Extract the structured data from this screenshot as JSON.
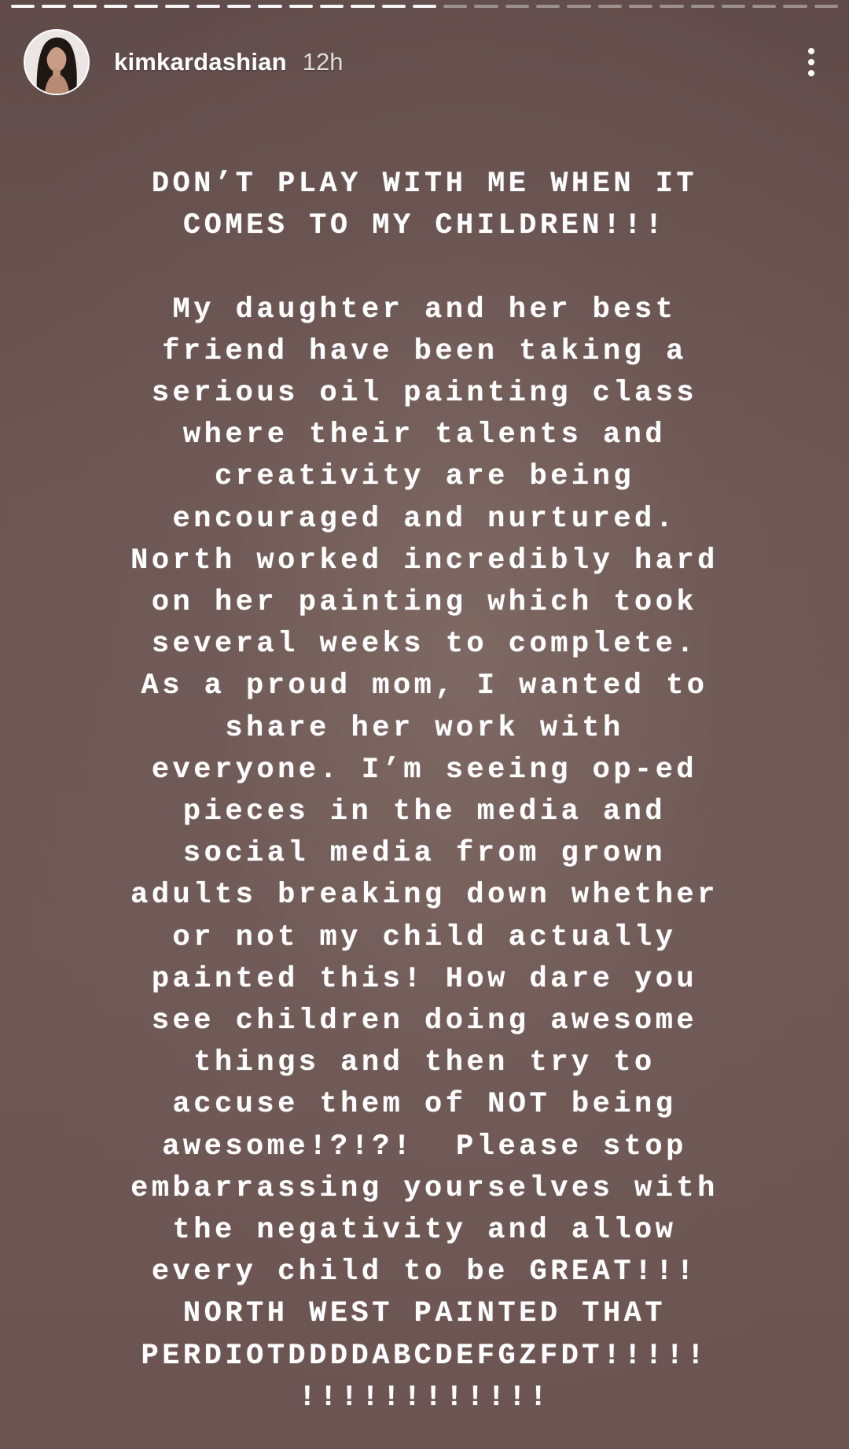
{
  "progress": {
    "segments_total": 27,
    "segments_viewed": 14
  },
  "header": {
    "username": "kimkardashian",
    "timestamp": "12h",
    "more_icon": "more-vertical-icon"
  },
  "story": {
    "text": "DON’T PLAY WITH ME WHEN IT\nCOMES TO MY CHILDREN!!!\n\nMy daughter and her best\nfriend have been taking a\nserious oil painting class\nwhere their talents and\ncreativity are being\nencouraged and nurtured.\nNorth worked incredibly hard\non her painting which took\nseveral weeks to complete.\nAs a proud mom, I wanted to\nshare her work with\neveryone. I’m seeing op-ed\npieces in the media and\nsocial media from grown\nadults breaking down whether\nor not my child actually\npainted this! How dare you\nsee children doing awesome\nthings and then try to\naccuse them of NOT being\nawesome!?!?!  Please stop\nembarrassing yourselves with\nthe negativity and allow\nevery child to be GREAT!!!\nNORTH WEST PAINTED THAT\nPERDIOTDDDDABCDEFGZFDT!!!!!\n!!!!!!!!!!!!",
    "text_color": "#ffffff",
    "background_color": "#6a5451"
  }
}
